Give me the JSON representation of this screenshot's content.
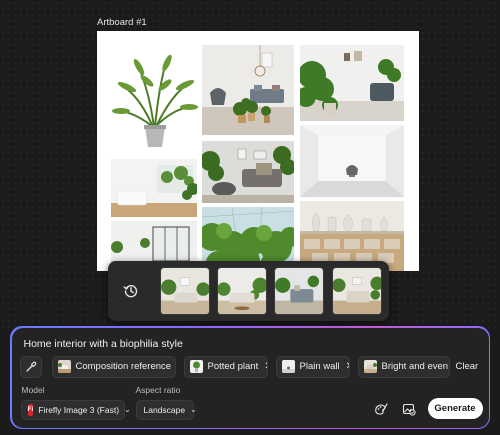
{
  "artboard": {
    "label": "Artboard #1"
  },
  "history": {
    "icon": "history-icon",
    "thumbnail_count": 4
  },
  "prompt": {
    "text": "Home interior with a biophilia style"
  },
  "chips": [
    {
      "label": "Composition reference",
      "thumb": "room-thumb"
    },
    {
      "label": "Potted plant",
      "thumb": "plant-thumb"
    },
    {
      "label": "Plain wall",
      "thumb": "wall-thumb"
    },
    {
      "label": "Bright and even",
      "thumb": "room-thumb"
    }
  ],
  "actions": {
    "clear_label": "Clear",
    "generate_label": "Generate",
    "remove_glyph": "✕"
  },
  "model": {
    "label": "Model",
    "value": "Firefly Image 3 (Fast)",
    "badge": "Fi"
  },
  "aspect_ratio": {
    "label": "Aspect ratio",
    "value": "Landscape"
  },
  "colors": {
    "accent_gradient_start": "#6b7bff",
    "accent_gradient_end": "#c25ad8",
    "brand_badge": "#d7262b"
  }
}
